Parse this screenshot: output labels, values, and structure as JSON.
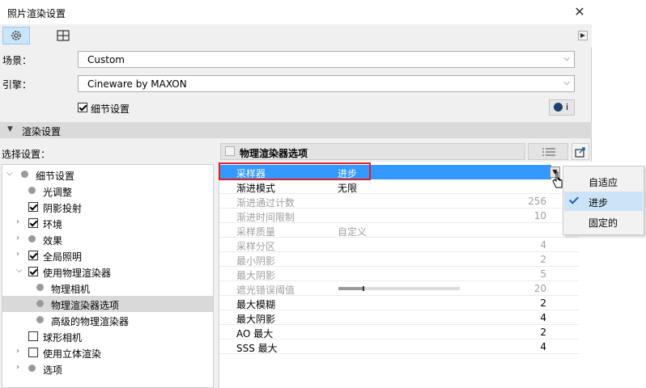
{
  "window": {
    "title": "照片渲染设置"
  },
  "toolbar": {
    "settings_tab_icon": "gear-icon",
    "layout_tab_icon": "grid-view-icon",
    "scroll_icon": "triangle-right-icon"
  },
  "scene": {
    "label": "场景：",
    "value": "Custom"
  },
  "engine": {
    "label": "引擎：",
    "value": "Cineware by MAXON"
  },
  "detail_settings": {
    "label": "细节设置",
    "checked": true,
    "info_icon": "info-icon",
    "info_text": "i"
  },
  "render_section": {
    "title": "渲染设置"
  },
  "select_settings": {
    "label": "选择设置："
  },
  "panel": {
    "title": "物理渲染器选项",
    "list_icon": "list-icon",
    "export_icon": "export-icon"
  },
  "tree": [
    {
      "label": "细节设置",
      "kind": "dot",
      "arrow": "down",
      "indent": 0
    },
    {
      "label": "光调整",
      "kind": "dot",
      "arrow": "",
      "indent": 1
    },
    {
      "label": "阴影投射",
      "kind": "check",
      "checked": true,
      "arrow": "",
      "indent": 1
    },
    {
      "label": "环境",
      "kind": "check",
      "checked": true,
      "arrow": "right",
      "indent": 1
    },
    {
      "label": "效果",
      "kind": "dot",
      "arrow": "right",
      "indent": 1
    },
    {
      "label": "全局照明",
      "kind": "check",
      "checked": true,
      "arrow": "right",
      "indent": 1
    },
    {
      "label": "使用物理渲染器",
      "kind": "check",
      "checked": true,
      "arrow": "down",
      "indent": 1
    },
    {
      "label": "物理相机",
      "kind": "dot",
      "arrow": "",
      "indent": 2
    },
    {
      "label": "物理渲染器选项",
      "kind": "dot",
      "arrow": "",
      "indent": 2,
      "selected": true
    },
    {
      "label": "高级的物理渲染器",
      "kind": "dot",
      "arrow": "",
      "indent": 2
    },
    {
      "label": "球形相机",
      "kind": "check",
      "checked": false,
      "arrow": "",
      "indent": 1
    },
    {
      "label": "使用立体渲染",
      "kind": "check",
      "checked": false,
      "arrow": "right",
      "indent": 1
    },
    {
      "label": "选项",
      "kind": "dot",
      "arrow": "right",
      "indent": 1
    }
  ],
  "properties": [
    {
      "name": "采样器",
      "value": "进步",
      "right": "",
      "state": "highlight"
    },
    {
      "name": "渐进模式",
      "value": "无限",
      "right": "",
      "state": "normal"
    },
    {
      "name": "渐进通过计数",
      "value": "",
      "right": "256",
      "state": "disabled"
    },
    {
      "name": "渐进时间限制",
      "value": "",
      "right": "10",
      "state": "disabled"
    },
    {
      "name": "采样质量",
      "value": "自定义",
      "right": "",
      "state": "disabled"
    },
    {
      "name": "采样分区",
      "value": "",
      "right": "4",
      "state": "disabled"
    },
    {
      "name": "最小阴影",
      "value": "",
      "right": "2",
      "state": "disabled"
    },
    {
      "name": "最大阴影",
      "value": "",
      "right": "5",
      "state": "disabled"
    },
    {
      "name": "遮光错误阈值",
      "value": "",
      "right": "20",
      "state": "disabled",
      "slider": 0.2
    },
    {
      "name": "最大模糊",
      "value": "",
      "right": "2",
      "state": "normal"
    },
    {
      "name": "最大阴影",
      "value": "",
      "right": "4",
      "state": "normal"
    },
    {
      "name": "AO 最大",
      "value": "",
      "right": "2",
      "state": "normal"
    },
    {
      "name": "SSS 最大",
      "value": "",
      "right": "4",
      "state": "normal"
    }
  ],
  "dropdown_menu": {
    "items": [
      {
        "label": "自适应",
        "checked": false,
        "selected": false
      },
      {
        "label": "进步",
        "checked": true,
        "selected": true
      },
      {
        "label": "固定的",
        "checked": false,
        "selected": false
      }
    ]
  },
  "colors": {
    "highlight": "#3399ff",
    "annotation_box": "#e02020",
    "menu_selected": "#cce4f7"
  }
}
